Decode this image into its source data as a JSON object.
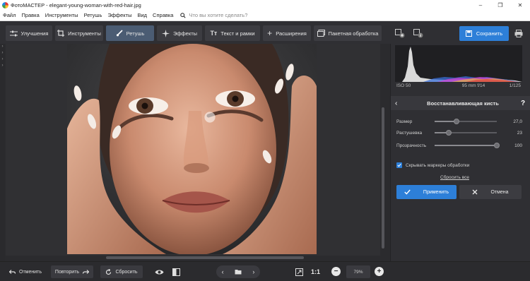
{
  "window": {
    "title": "ФотоМАСТЕР - elegant-young-woman-with-red-hair.jpg",
    "minimize": "–",
    "maximize": "❐",
    "close": "✕"
  },
  "menu": {
    "items": [
      "Файл",
      "Правка",
      "Инструменты",
      "Ретушь",
      "Эффекты",
      "Вид",
      "Справка"
    ],
    "search_placeholder": "Что вы хотите сделать?"
  },
  "toolbar": {
    "tabs": [
      {
        "label": "Улучшения",
        "icon": "sliders-icon",
        "active": false
      },
      {
        "label": "Инструменты",
        "icon": "crop-icon",
        "active": false
      },
      {
        "label": "Ретушь",
        "icon": "brush-icon",
        "active": true
      },
      {
        "label": "Эффекты",
        "icon": "sparkle-icon",
        "active": false
      },
      {
        "label": "Текст и рамки",
        "icon": "text-icon",
        "active": false
      },
      {
        "label": "Расширения",
        "icon": "plus-icon",
        "active": false
      },
      {
        "label": "Пакетная обработка",
        "icon": "batch-icon",
        "active": false
      }
    ],
    "save_label": "Сохранить"
  },
  "exif": {
    "iso": "ISO 50",
    "lens": "95 mm f/14",
    "shutter": "1/125"
  },
  "panel": {
    "title": "Восстанавливающая кисть",
    "sliders": [
      {
        "label": "Размер",
        "value": "27,0",
        "level": 0.35
      },
      {
        "label": "Растушевка",
        "value": "23",
        "level": 0.23
      },
      {
        "label": "Прозрачность",
        "value": "100",
        "level": 1.0
      }
    ],
    "checkbox_label": "Скрывать маркеры обработки",
    "checkbox_checked": true,
    "reset_label": "Сбросить все",
    "apply_label": "Применить",
    "cancel_label": "Отмена"
  },
  "bottom": {
    "undo_label": "Отменить",
    "redo_label": "Повторить",
    "reset_label": "Сбросить",
    "ratio_label": "1:1",
    "zoom": "79%"
  },
  "colors": {
    "accent": "#2d7fd8",
    "active_tab": "#4b5c73"
  }
}
